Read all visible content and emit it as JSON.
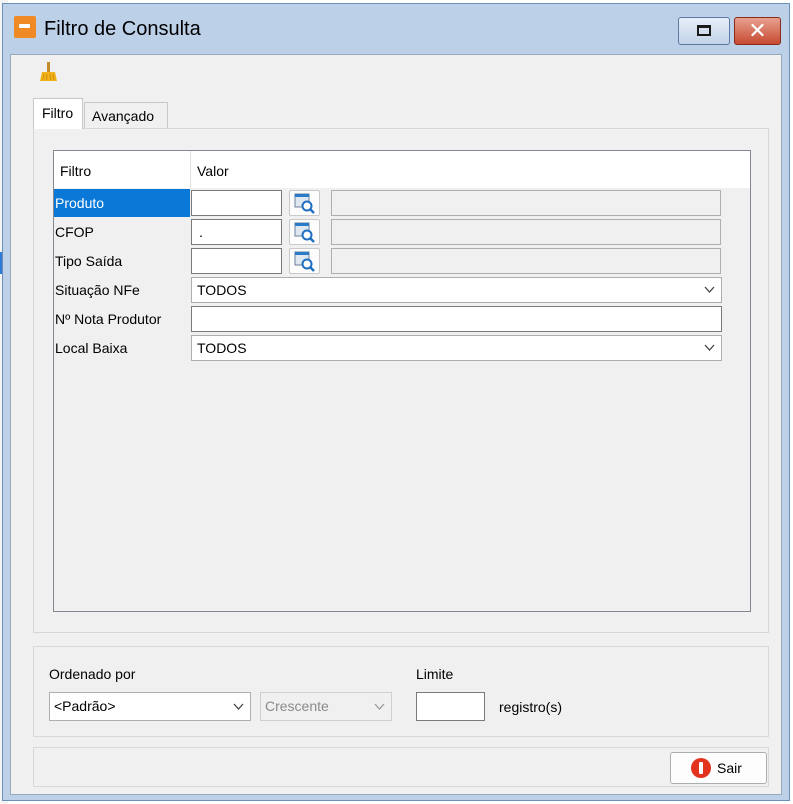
{
  "window": {
    "title": "Filtro de Consulta"
  },
  "toolbar": {
    "clear_icon": "broom-icon"
  },
  "tabs": [
    {
      "label": "Filtro",
      "active": true
    },
    {
      "label": "Avançado",
      "active": false
    }
  ],
  "grid": {
    "headers": {
      "filtro": "Filtro",
      "valor": "Valor"
    },
    "rows": [
      {
        "label": "Produto",
        "value": "",
        "type": "lookup",
        "selected": true
      },
      {
        "label": "CFOP",
        "value": ".",
        "type": "lookup",
        "selected": false
      },
      {
        "label": "Tipo Saída",
        "value": "",
        "type": "lookup",
        "selected": false
      },
      {
        "label": "Situação NFe",
        "value": "TODOS",
        "type": "combo",
        "selected": false
      },
      {
        "label": "Nº Nota Produtor",
        "value": "",
        "type": "text",
        "selected": false
      },
      {
        "label": "Local Baixa",
        "value": "TODOS",
        "type": "combo",
        "selected": false
      }
    ]
  },
  "order": {
    "label": "Ordenado por",
    "value": "<Padrão>",
    "direction": "Crescente",
    "limit_label": "Limite",
    "limit_value": "",
    "records_label": "registro(s)"
  },
  "footer": {
    "exit_label": "Sair"
  },
  "colors": {
    "selection": "#0a78d7",
    "title_bar": "#bcd0e8",
    "close_button": "#c74a31",
    "exit_icon": "#e3331e"
  }
}
